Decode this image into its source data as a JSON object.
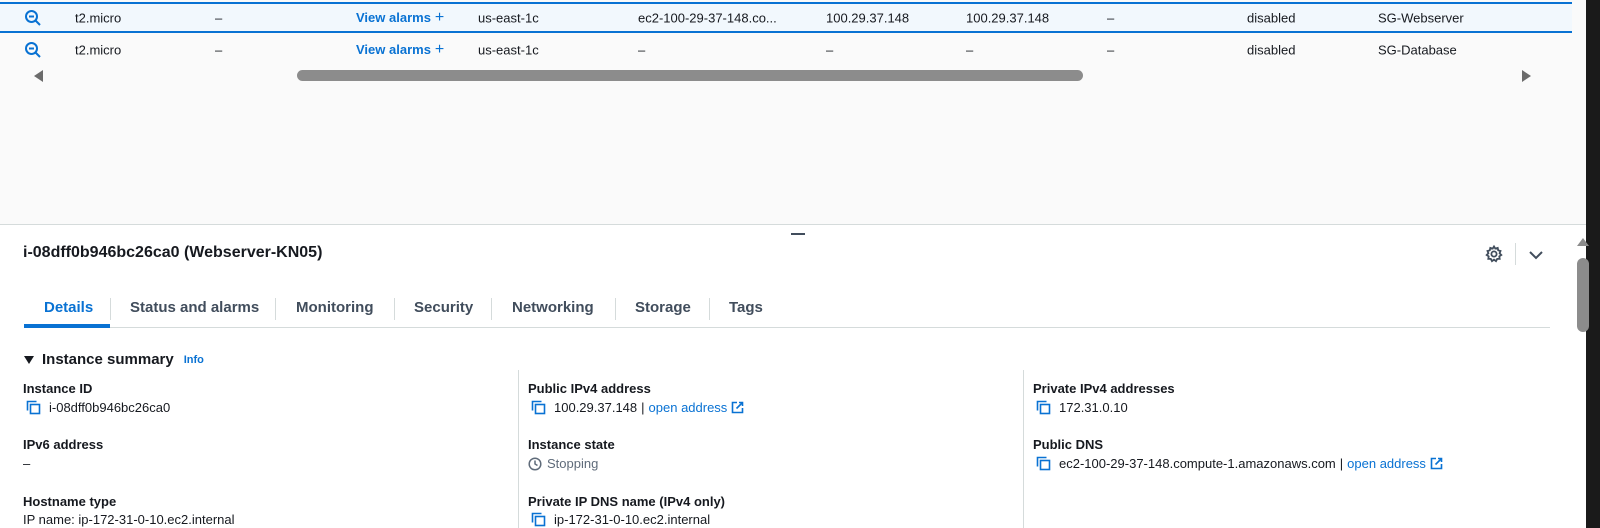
{
  "table": {
    "rows": [
      {
        "type": "t2.micro",
        "status_check": "–",
        "alarm_label": "View alarms",
        "alarm_plus": "+",
        "az": "us-east-1c",
        "public_dns": "ec2-100-29-37-148.co...",
        "public_ipv4": "100.29.37.148",
        "elastic_ip": "100.29.37.148",
        "ipv6": "–",
        "monitoring": "disabled",
        "security_group": "SG-Webserver",
        "selected": true
      },
      {
        "type": "t2.micro",
        "status_check": "–",
        "alarm_label": "View alarms",
        "alarm_plus": "+",
        "az": "us-east-1c",
        "public_dns": "–",
        "public_ipv4": "–",
        "elastic_ip": "–",
        "ipv6": "–",
        "monitoring": "disabled",
        "security_group": "SG-Database",
        "selected": false
      }
    ]
  },
  "details": {
    "title": "i-08dff0b946bc26ca0 (Webserver-KN05)",
    "tabs": [
      {
        "label": "Details",
        "active": true
      },
      {
        "label": "Status and alarms",
        "active": false
      },
      {
        "label": "Monitoring",
        "active": false
      },
      {
        "label": "Security",
        "active": false
      },
      {
        "label": "Networking",
        "active": false
      },
      {
        "label": "Storage",
        "active": false
      },
      {
        "label": "Tags",
        "active": false
      }
    ],
    "section": {
      "title": "Instance summary",
      "info": "Info"
    },
    "fields": {
      "instance_id": {
        "label": "Instance ID",
        "value": "i-08dff0b946bc26ca0"
      },
      "ipv6": {
        "label": "IPv6 address",
        "value": "–"
      },
      "hostname_type": {
        "label": "Hostname type",
        "value": "IP name: ip-172-31-0-10.ec2.internal"
      },
      "public_ipv4": {
        "label": "Public IPv4 address",
        "value": "100.29.37.148",
        "sep": "|",
        "link": "open address"
      },
      "instance_state": {
        "label": "Instance state",
        "value": "Stopping"
      },
      "private_ip_dns": {
        "label": "Private IP DNS name (IPv4 only)",
        "value": "ip-172-31-0-10.ec2.internal"
      },
      "private_ipv4": {
        "label": "Private IPv4 addresses",
        "value": "172.31.0.10"
      },
      "public_dns": {
        "label": "Public DNS",
        "value": "ec2-100-29-37-148.compute-1.amazonaws.com",
        "sep": "|",
        "link": "open address"
      }
    }
  },
  "colors": {
    "accent": "#0972d3",
    "text": "#16191f",
    "muted": "#5f6b7a",
    "divider": "#d5dbdb"
  },
  "icons": {
    "row_action": "zoom-out-icon",
    "copy": "copy-icon",
    "external": "external-link-icon",
    "state": "clock-icon",
    "settings": "gear-icon",
    "collapse": "chevron-down-icon"
  }
}
